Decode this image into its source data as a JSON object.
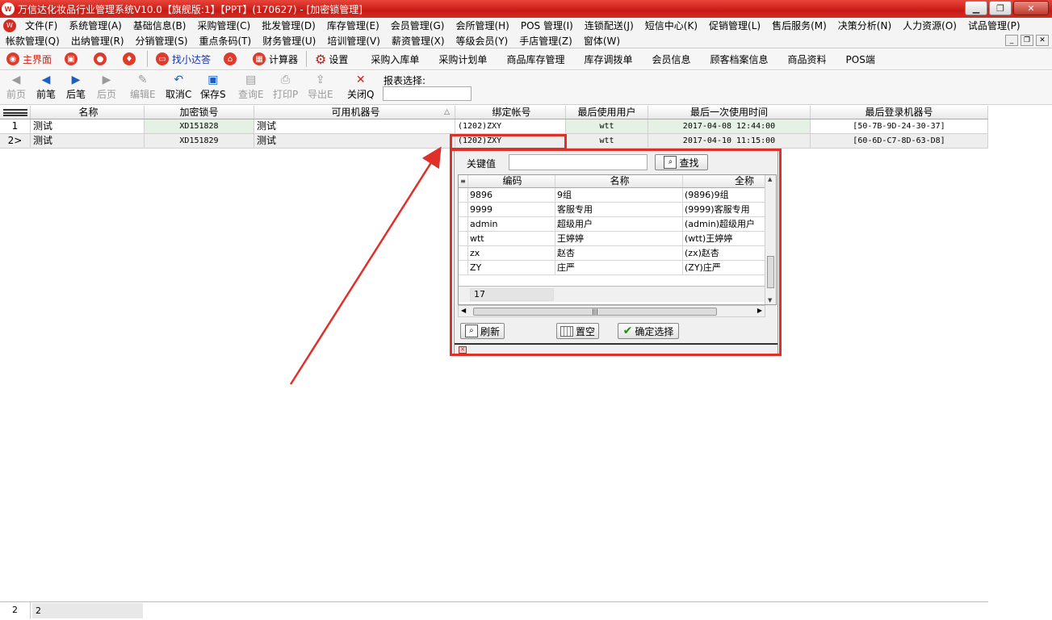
{
  "window": {
    "title": "万信达化妆品行业管理系统V10.0【旗舰版:1】【PPT】(170627) - [加密锁管理]",
    "controls": [
      "minimize",
      "restore",
      "close"
    ]
  },
  "menu1": [
    "文件(F)",
    "系统管理(A)",
    "基础信息(B)",
    "采购管理(C)",
    "批发管理(D)",
    "库存管理(E)",
    "会员管理(G)",
    "会所管理(H)",
    "POS 管理(I)",
    "连锁配送(J)",
    "短信中心(K)",
    "促销管理(L)",
    "售后服务(M)",
    "决策分析(N)",
    "人力资源(O)",
    "试品管理(P)"
  ],
  "menu2": [
    "帐款管理(Q)",
    "出纳管理(R)",
    "分销管理(S)",
    "重点条码(T)",
    "财务管理(U)",
    "培训管理(V)",
    "薪资管理(X)",
    "等级会员(Y)",
    "手店管理(Z)",
    "窗体(W)"
  ],
  "quickbar": {
    "home": "主界面",
    "find": "找小达答",
    "calc": "计算器",
    "settings": "设置",
    "links": [
      "采购入库单",
      "采购计划单",
      "商品库存管理",
      "库存调拨单",
      "会员信息",
      "顾客档案信息",
      "商品资料",
      "POS端"
    ]
  },
  "toolbar": {
    "buttons": [
      {
        "label": "前页",
        "enabled": false
      },
      {
        "label": "前笔",
        "enabled": true
      },
      {
        "label": "后笔",
        "enabled": true
      },
      {
        "label": "后页",
        "enabled": false
      },
      {
        "label": "编辑E",
        "enabled": false
      },
      {
        "label": "取消C",
        "enabled": true
      },
      {
        "label": "保存S",
        "enabled": true
      },
      {
        "label": "查询E",
        "enabled": false
      },
      {
        "label": "打印P",
        "enabled": false
      },
      {
        "label": "导出E",
        "enabled": false
      },
      {
        "label": "关闭Q",
        "enabled": true
      }
    ],
    "report_label": "报表选择:"
  },
  "grid": {
    "headers": [
      "",
      "名称",
      "加密锁号",
      "可用机器号",
      "绑定帐号",
      "最后使用用户",
      "最后一次使用时间",
      "最后登录机器号"
    ],
    "rows": [
      {
        "num": "1",
        "name": "测试",
        "lock": "XD151828",
        "machine": "测试",
        "account": "(1202)ZXY",
        "user": "wtt",
        "time": "2017-04-08 12:44:00",
        "mac": "[50-7B-9D-24-30-37]"
      },
      {
        "num": "2>",
        "name": "测试",
        "lock": "XD151829",
        "machine": "测试",
        "account": "(1202)ZXY",
        "user": "wtt",
        "time": "2017-04-10 11:15:00",
        "mac": "[60-6D-C7-8D-63-D8]"
      }
    ]
  },
  "popup": {
    "keyword_label": "关键值",
    "keyword_value": "",
    "search_button": "查找",
    "headers": [
      "编码",
      "名称",
      "全称"
    ],
    "rows": [
      {
        "code": "9896",
        "name": "9组",
        "full": "(9896)9组"
      },
      {
        "code": "9999",
        "name": "客服专用",
        "full": "(9999)客服专用"
      },
      {
        "code": "admin",
        "name": "超级用户",
        "full": "(admin)超级用户"
      },
      {
        "code": "wtt",
        "name": "王婷婷",
        "full": "(wtt)王婷婷"
      },
      {
        "code": "zx",
        "name": "赵杏",
        "full": "(zx)赵杏"
      },
      {
        "code": "ZY",
        "name": "庄严",
        "full": "(ZY)庄严"
      }
    ],
    "count": "17",
    "refresh": "刷新",
    "clear": "置空",
    "confirm": "确定选择"
  },
  "statusbar": {
    "left": "2",
    "right": "2"
  },
  "colors": {
    "title_red": "#d52c22",
    "highlight": "#e0302a",
    "green_tint": "#e6f1e6"
  }
}
